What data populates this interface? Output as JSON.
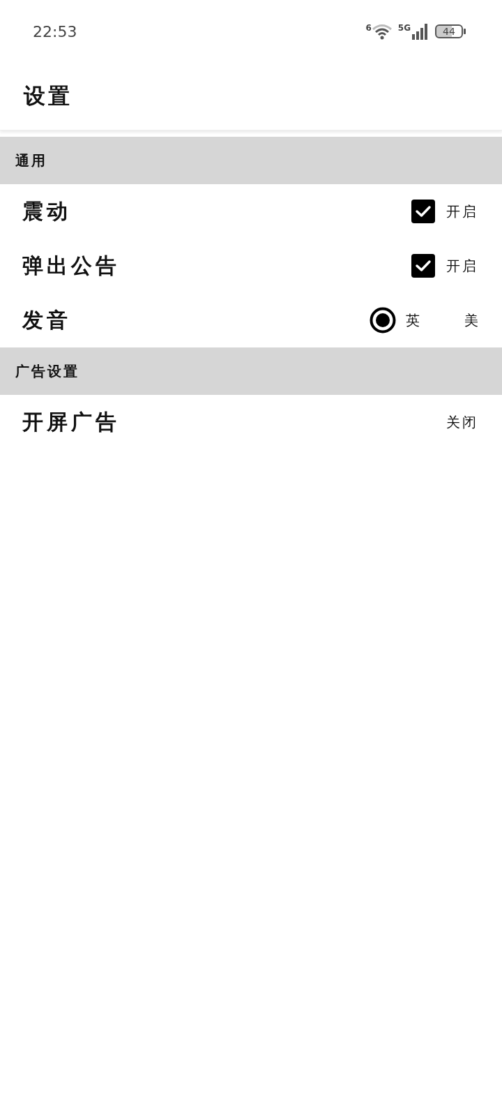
{
  "status_bar": {
    "time": "22:53",
    "wifi_badge": "6",
    "network": "5G",
    "battery": "44"
  },
  "app_bar": {
    "title": "设置"
  },
  "sections": [
    {
      "title": "通用",
      "items": [
        {
          "kind": "checkbox",
          "label": "震动",
          "checked": true,
          "value": "开启"
        },
        {
          "kind": "checkbox",
          "label": "弹出公告",
          "checked": true,
          "value": "开启"
        },
        {
          "kind": "radio",
          "label": "发音",
          "options": [
            {
              "label": "英",
              "selected": true
            },
            {
              "label": "美",
              "selected": false
            }
          ]
        }
      ]
    },
    {
      "title": "广告设置",
      "items": [
        {
          "kind": "text",
          "label": "开屏广告",
          "value": "关闭"
        }
      ]
    }
  ]
}
